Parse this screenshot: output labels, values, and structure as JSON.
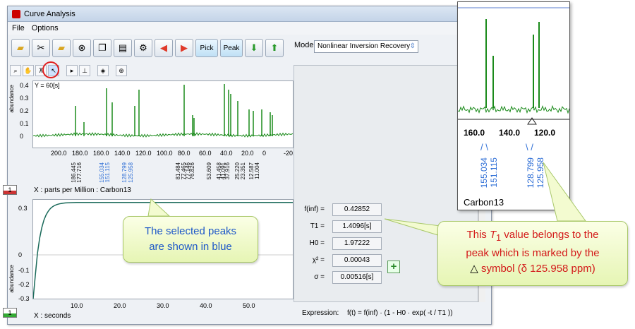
{
  "window": {
    "title": "Curve Analysis"
  },
  "menu": {
    "file": "File",
    "options": "Options"
  },
  "toolbar": {
    "pick": "Pick",
    "peak": "Peak"
  },
  "mode": {
    "label": "Mode:",
    "value": "Nonlinear Inversion Recovery"
  },
  "spectrum": {
    "y_annotation": "Y = 60[s]",
    "y_label": "abundance",
    "y_ticks": [
      "0.4",
      "0.3",
      "0.2",
      "0.1",
      "0"
    ],
    "x_ticks": [
      "200.0",
      "180.0",
      "160.0",
      "140.0",
      "120.0",
      "100.0",
      "80.0",
      "60.0",
      "40.0",
      "20.0",
      "0",
      "-20.0"
    ],
    "x_caption": "X : parts per Million : Carbon13",
    "peak_labels": [
      {
        "ppm": "186.445",
        "selected": false
      },
      {
        "ppm": "177.716",
        "selected": false
      },
      {
        "ppm": "155.034",
        "selected": true
      },
      {
        "ppm": "151.115",
        "selected": true
      },
      {
        "ppm": "128.799",
        "selected": true
      },
      {
        "ppm": "125.958",
        "selected": true
      },
      {
        "ppm": "81.484",
        "selected": false
      },
      {
        "ppm": "77.465",
        "selected": false
      },
      {
        "ppm": "77.146",
        "selected": false
      },
      {
        "ppm": "76.826",
        "selected": false
      },
      {
        "ppm": "53.609",
        "selected": false
      },
      {
        "ppm": "41.458",
        "selected": false
      },
      {
        "ppm": "41.091",
        "selected": false
      },
      {
        "ppm": "37.916",
        "selected": false
      },
      {
        "ppm": "25.220",
        "selected": false
      },
      {
        "ppm": "23.351",
        "selected": false
      },
      {
        "ppm": "12.587",
        "selected": false
      },
      {
        "ppm": "11.004",
        "selected": false
      }
    ],
    "channel": "1"
  },
  "decay": {
    "y_label": "abundance",
    "y_ticks": [
      "0.3",
      "0",
      "-0.1",
      "-0.2",
      "-0.3"
    ],
    "x_ticks": [
      "10.0",
      "20.0",
      "30.0",
      "40.0",
      "50.0"
    ],
    "x_caption": "X : seconds",
    "channel": "1"
  },
  "params": [
    {
      "label": "f(inf) =",
      "value": "0.42852"
    },
    {
      "label": "T1 =",
      "value": "1.4096[s]"
    },
    {
      "label": "H0 =",
      "value": "1.97222"
    },
    {
      "label": "χ² =",
      "value": "0.00043"
    },
    {
      "label": "σ =",
      "value": "0.00516[s]"
    }
  ],
  "expression": {
    "label": "Expression:",
    "value": "f(t) = f(inf) · (1 - H0 · exp( -t / T1 ))"
  },
  "zoom": {
    "x_ticks": [
      "160.0",
      "140.0",
      "120.0"
    ],
    "labels_a": [
      "155.034",
      "151.115"
    ],
    "labels_b": [
      "128.799",
      "125.958"
    ],
    "nucleus": "Carbon13"
  },
  "callouts": {
    "blue_line1": "The selected peaks",
    "blue_line2": "are shown in blue",
    "red_line1a": "This ",
    "red_T": "T",
    "red_sub": "1",
    "red_line1b": " value belongs to the",
    "red_line2": "peak which is marked by the",
    "red_line3": " symbol (δ 125.958 ppm)"
  }
}
